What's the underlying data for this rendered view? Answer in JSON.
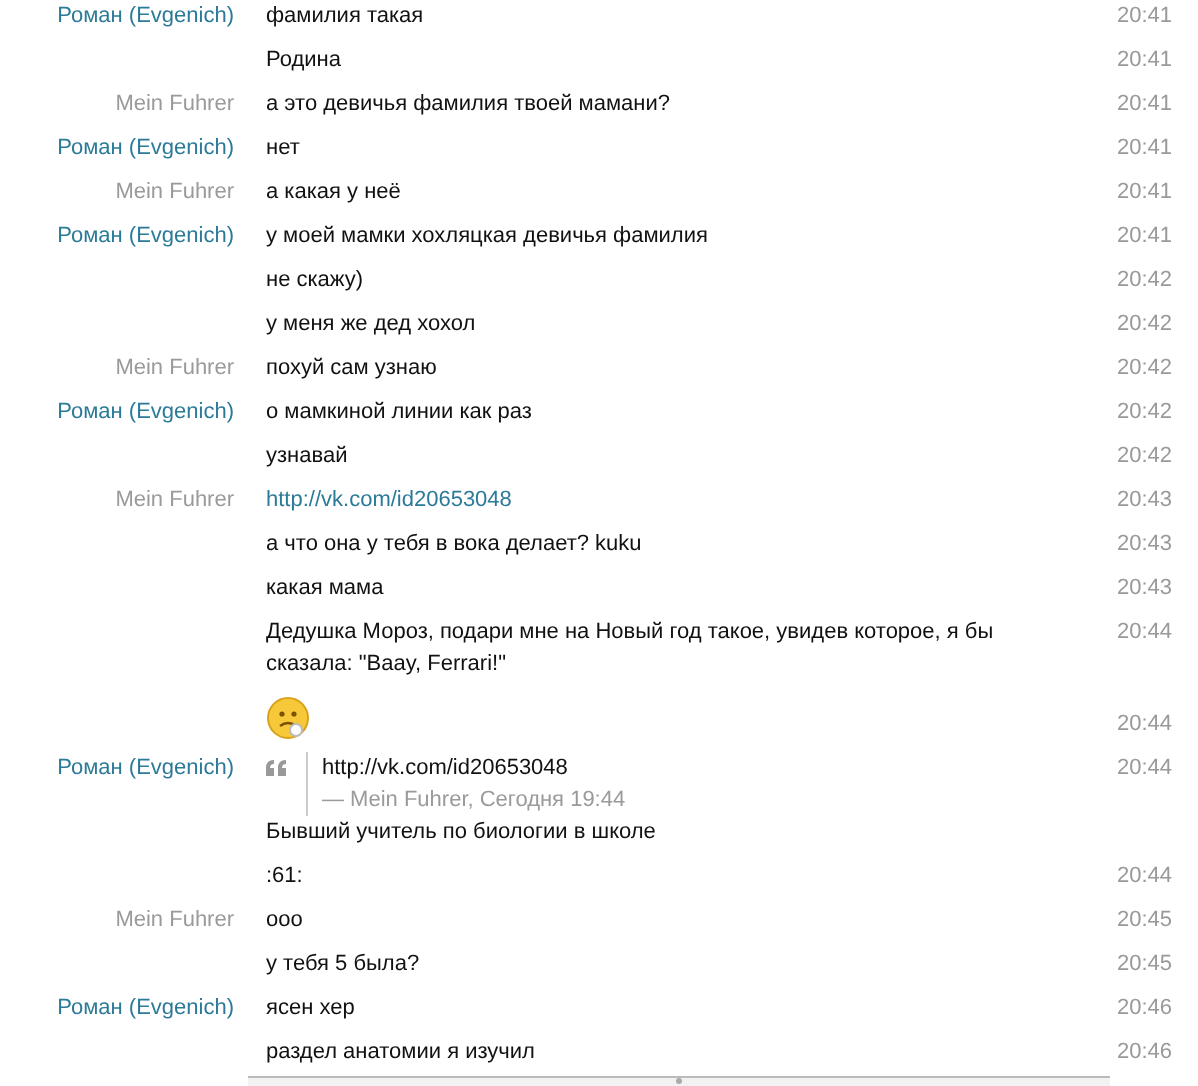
{
  "messages": [
    {
      "sender": "Роман (Evgenich)",
      "color": "#2b7a98",
      "kind": "text",
      "text": "фамилия такая",
      "time": "20:41"
    },
    {
      "kind": "text",
      "text": "Родина",
      "time": "20:41"
    },
    {
      "sender": "Mein Fuhrer",
      "color": "#9a9a9a",
      "kind": "text",
      "text": "а это девичья фамилия твоей мамани?",
      "time": "20:41"
    },
    {
      "sender": "Роман (Evgenich)",
      "color": "#2b7a98",
      "kind": "text",
      "text": "нет",
      "time": "20:41"
    },
    {
      "sender": "Mein Fuhrer",
      "color": "#9a9a9a",
      "kind": "text",
      "text": "а какая у неё",
      "time": "20:41"
    },
    {
      "sender": "Роман (Evgenich)",
      "color": "#2b7a98",
      "kind": "text",
      "text": "у моей мамки хохляцкая девичья фамилия",
      "time": "20:41"
    },
    {
      "kind": "text",
      "text": "не скажу)",
      "time": "20:42"
    },
    {
      "kind": "text",
      "text": "у меня же дед хохол",
      "time": "20:42"
    },
    {
      "sender": "Mein Fuhrer",
      "color": "#9a9a9a",
      "kind": "text",
      "text": "похуй сам узнаю",
      "time": "20:42"
    },
    {
      "sender": "Роман (Evgenich)",
      "color": "#2b7a98",
      "kind": "text",
      "text": "о мамкиной линии как раз",
      "time": "20:42"
    },
    {
      "kind": "text",
      "text": "узнавай",
      "time": "20:42"
    },
    {
      "sender": "Mein Fuhrer",
      "color": "#9a9a9a",
      "kind": "link",
      "text": "http://vk.com/id20653048",
      "time": "20:43"
    },
    {
      "kind": "text",
      "text": "а что она у тебя в вока делает? kuku",
      "time": "20:43"
    },
    {
      "kind": "text",
      "text": "какая мама",
      "time": "20:43"
    },
    {
      "kind": "text",
      "text": "Дедушка Мороз, подари мне на Новый год такое, увидев которое, я бы сказала: \"Baay, Ferrari!\"",
      "time": "20:44"
    },
    {
      "kind": "emoji",
      "time": "20:44"
    },
    {
      "sender": "Роман (Evgenich)",
      "color": "#2b7a98",
      "kind": "quote",
      "quote": "http://vk.com/id20653048",
      "attribution": "— Mein Fuhrer, Сегодня 19:44",
      "text": "Бывший учитель по биологии в школе",
      "time": "20:44"
    },
    {
      "kind": "text",
      "text": ":61:",
      "time": "20:44"
    },
    {
      "sender": "Mein Fuhrer",
      "color": "#9a9a9a",
      "kind": "text",
      "text": "ooo",
      "time": "20:45"
    },
    {
      "kind": "text",
      "text": "у тебя 5 была?",
      "time": "20:45"
    },
    {
      "sender": "Роман (Evgenich)",
      "color": "#2b7a98",
      "kind": "text",
      "text": "ясен хер",
      "time": "20:46"
    },
    {
      "kind": "text",
      "text": "раздел анатомии я изучил",
      "time": "20:46"
    }
  ]
}
